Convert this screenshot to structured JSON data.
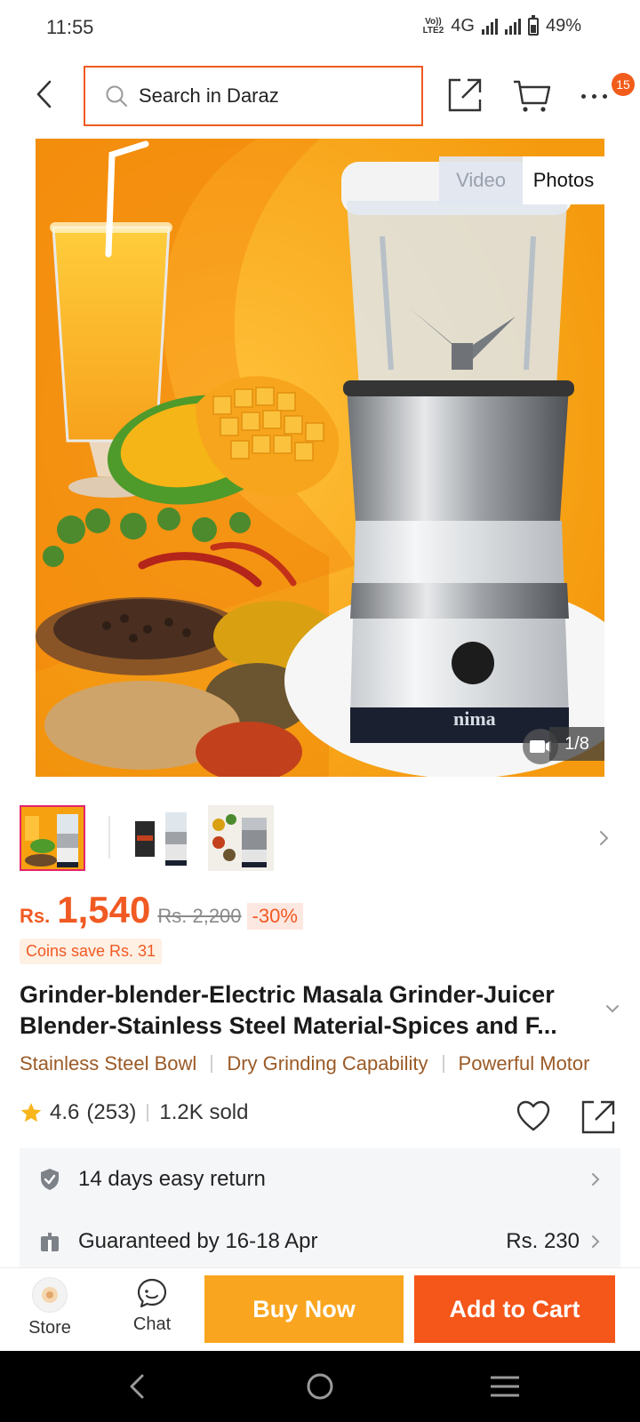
{
  "status_bar": {
    "time": "11:55",
    "volte_top": "Vo))",
    "volte_bottom": "LTE2",
    "network": "4G",
    "battery": "49%"
  },
  "header": {
    "search_placeholder": "Search in Daraz",
    "cart_badge": "15"
  },
  "gallery": {
    "tab_video": "Video",
    "tab_photos": "Photos",
    "counter": "1/8",
    "brand_text": "nima",
    "thumbnail_count": 3
  },
  "price": {
    "currency": "Rs.",
    "current": "1,540",
    "original": "Rs. 2,200",
    "discount": "-30%",
    "coins": "Coins save Rs. 31"
  },
  "product": {
    "title": "Grinder-blender-Electric Masala Grinder-Juicer Blender-Stainless Steel Material-Spices and F...",
    "tags": [
      "Stainless Steel Bowl",
      "Dry Grinding Capability",
      "Powerful Motor"
    ],
    "rating": "4.6",
    "reviews": "(253)",
    "sold": "1.2K sold"
  },
  "services": {
    "return_text": "14 days easy return",
    "delivery_text": "Guaranteed by 16-18 Apr",
    "delivery_fee": "Rs. 230"
  },
  "bottom_bar": {
    "store_label": "Store",
    "chat_label": "Chat",
    "buy_now": "Buy Now",
    "add_to_cart": "Add to Cart"
  },
  "colors": {
    "accent": "#f05a22",
    "buy_now": "#f9a51f",
    "add_to_cart": "#f5561a",
    "tag_text": "#9b5a26"
  }
}
